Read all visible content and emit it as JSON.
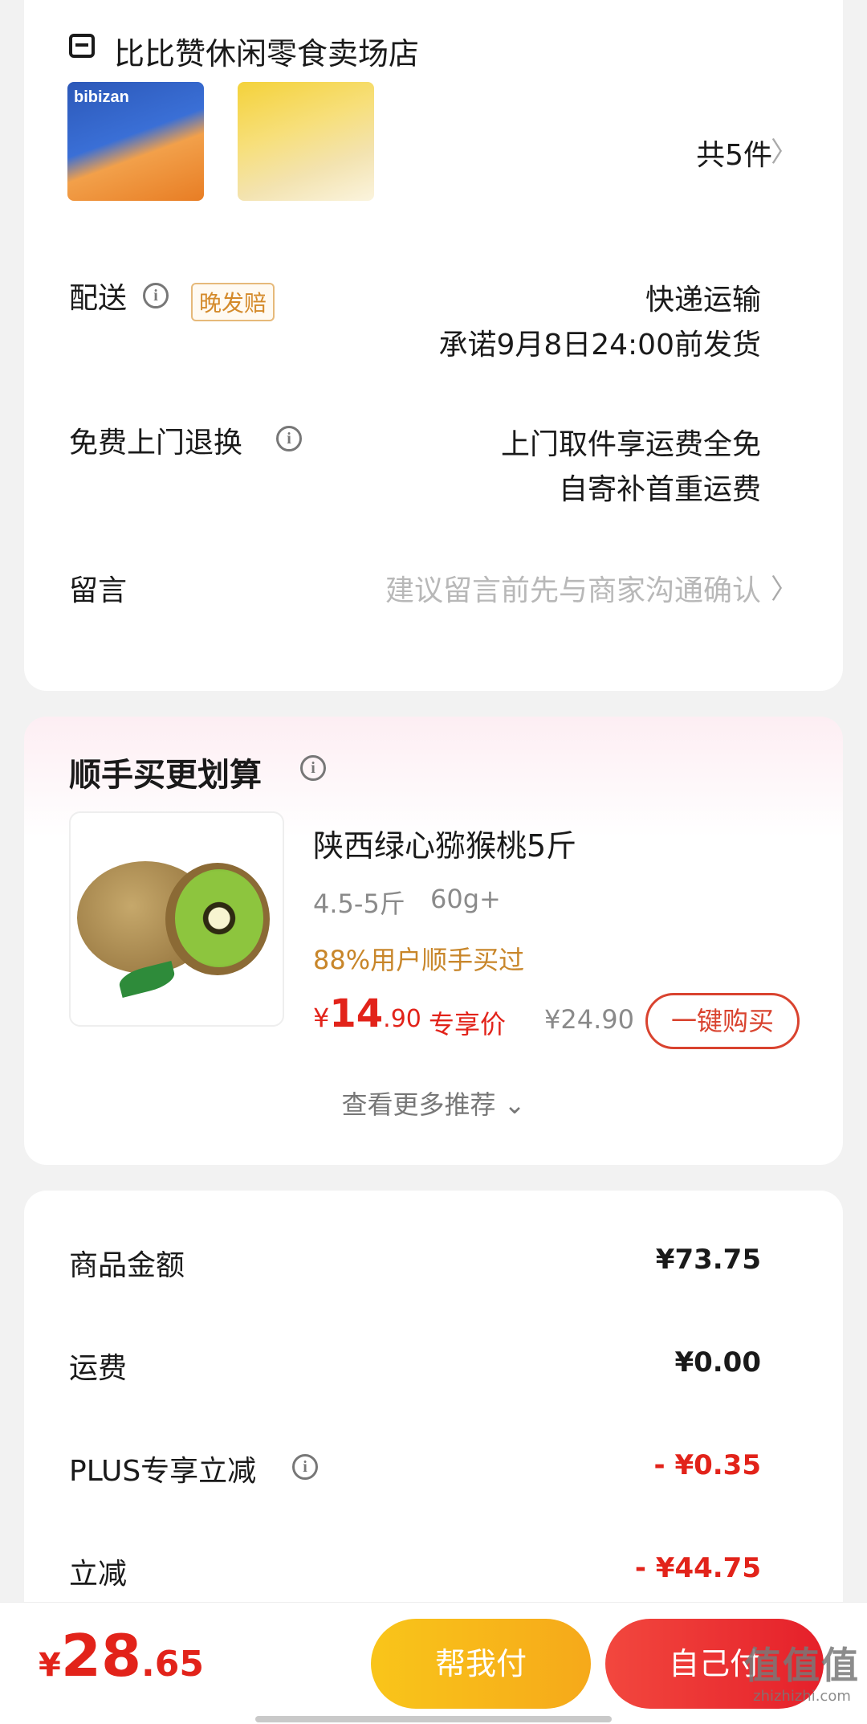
{
  "store": {
    "name": "比比赞休闲零食卖场店",
    "item_count": "共5件",
    "thumb1_brand": "bibizan",
    "delivery": {
      "label": "配送",
      "badge": "晚发赔",
      "method": "快递运输",
      "promise": "承诺9月8日24:00前发货"
    },
    "return": {
      "label": "免费上门退换",
      "line1": "上门取件享运费全免",
      "line2": "自寄补首重运费"
    },
    "message": {
      "label": "留言",
      "placeholder": "建议留言前先与商家沟通确认"
    }
  },
  "recommend": {
    "title": "顺手买更划算",
    "product": {
      "name": "陕西绿心猕猴桃5斤",
      "spec1": "4.5-5斤",
      "spec2": "60g+",
      "social": "88%用户顺手买过",
      "price_currency": "¥",
      "price_int": "14",
      "price_dec": ".90",
      "price_tag": "专享价",
      "original_price": "¥24.90",
      "buy_label": "一键购买"
    },
    "more_label": "查看更多推荐 ⌄"
  },
  "summary": {
    "rows": [
      {
        "label": "商品金额",
        "value": "¥73.75"
      },
      {
        "label": "运费",
        "value": "¥0.00"
      },
      {
        "label": "PLUS专享立减",
        "value": "- ¥0.35"
      },
      {
        "label": "立减",
        "value": "- ¥44.75"
      }
    ]
  },
  "bottom": {
    "currency": "¥",
    "total_int": "28",
    "total_dec": ".65",
    "help_pay": "帮我付",
    "self_pay": "自己付"
  },
  "watermark": {
    "logo": "值值值",
    "url": "zhizhizhi.com"
  },
  "icons": {
    "info": "i",
    "chevron": "〉"
  },
  "colors": {
    "accent_red": "#e2231a",
    "orange": "#f6a91a",
    "badge_gold": "#d48a2a"
  }
}
